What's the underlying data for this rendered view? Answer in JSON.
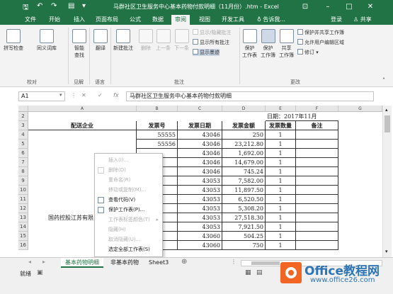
{
  "window": {
    "title": "马群社区卫生服务中心基本药物付款明细（11月份）.htm - Excel",
    "quick_access": [
      "save",
      "undo",
      "redo",
      "customize"
    ]
  },
  "menu_tabs": [
    "文件",
    "开始",
    "插入",
    "页面布局",
    "公式",
    "数据",
    "审阅",
    "视图",
    "开发工具"
  ],
  "active_tab": "审阅",
  "tell_me": "告诉我...",
  "login": "登录",
  "share": "共享",
  "ribbon": {
    "proofing": {
      "label": "校对",
      "spell": "拼写检查",
      "thesaurus": "同义词库"
    },
    "insights": {
      "label": "见解",
      "smart_lookup": "智能\n查找"
    },
    "language": {
      "label": "语言",
      "translate": "翻译"
    },
    "comments": {
      "label": "批注",
      "new": "新建批注",
      "delete": "删除",
      "prev": "上一条",
      "next": "下一条",
      "show_hide": "显示/隐藏批注",
      "show_all": "显示所有批注",
      "show_ink": "显示墨迹"
    },
    "changes": {
      "label": "更改",
      "protect_sheet": "保护\n工作表",
      "protect_workbook": "保护\n工作簿",
      "share_workbook": "共享\n工作簿",
      "protect_share": "保护并共享工作簿",
      "allow_edit": "允许用户编辑区域",
      "track": "修订"
    }
  },
  "formula_bar": {
    "name_box": "A1",
    "fx": "fx",
    "content": "马群社区卫生服务中心基本药物付款明细"
  },
  "columns": [
    "A",
    "B",
    "C",
    "D",
    "E",
    "F",
    "G"
  ],
  "rows": [
    "2",
    "3",
    "4",
    "5",
    "6",
    "7",
    "8",
    "9",
    "10",
    "11",
    "12",
    "13",
    "14",
    "15",
    "16"
  ],
  "sheet": {
    "date_label": "日期：2017年11月",
    "headers": [
      "配送企业",
      "发票号",
      "发票日期",
      "发票金额",
      "发票数量",
      "备注"
    ],
    "company": "国药控股江苏有限",
    "data_rows": [
      [
        "55555",
        "43046",
        "250",
        "1"
      ],
      [
        "55556",
        "43046",
        "23,212.80",
        "1"
      ],
      [
        "",
        "43046",
        "1,692.00",
        "1"
      ],
      [
        "",
        "43046",
        "14,679.00",
        "1"
      ],
      [
        "",
        "43046",
        "745.24",
        "1"
      ],
      [
        "",
        "43053",
        "7,582.00",
        "1"
      ],
      [
        "",
        "43053",
        "11,897.50",
        "1"
      ],
      [
        "",
        "43053",
        "6,520.50",
        "1"
      ],
      [
        "",
        "43053",
        "5,308.20",
        "1"
      ],
      [
        "",
        "43053",
        "27,518.30",
        "1"
      ],
      [
        "",
        "43053",
        "7,921.50",
        "1"
      ],
      [
        "",
        "43060",
        "504.25",
        "1"
      ],
      [
        "",
        "43060",
        "750",
        "1"
      ]
    ]
  },
  "context_menu": [
    {
      "label": "插入(I)...",
      "enabled": false
    },
    {
      "label": "删除(D)",
      "enabled": false
    },
    {
      "label": "重命名(R)",
      "enabled": false
    },
    {
      "label": "移动或复制(M)...",
      "enabled": false
    },
    {
      "label": "查看代码(V)",
      "enabled": true
    },
    {
      "label": "保护工作表(P)...",
      "enabled": true
    },
    {
      "label": "工作表标签颜色(T)",
      "enabled": false
    },
    {
      "label": "隐藏(H)",
      "enabled": false
    },
    {
      "label": "取消隐藏(U)...",
      "enabled": false
    },
    {
      "label": "选定全部工作表(S)",
      "enabled": true
    }
  ],
  "sheet_tabs": [
    "基本药物明细",
    "非基本药物",
    "Sheet3"
  ],
  "status": {
    "ready": "就绪"
  },
  "watermark": {
    "line1": "Office教程网",
    "line2": "www.office26.com"
  }
}
